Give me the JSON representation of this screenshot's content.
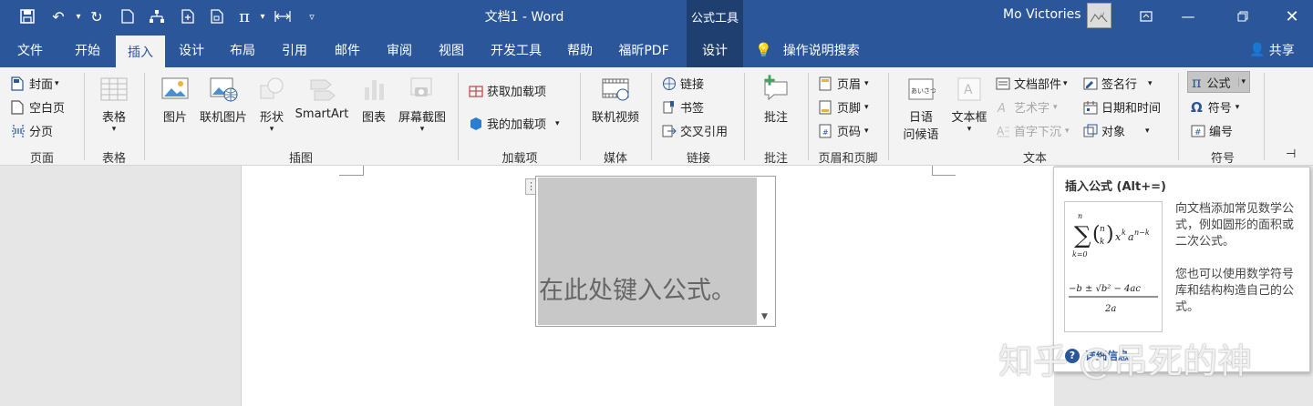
{
  "window": {
    "doc_title": "文档1 - Word",
    "context_tab": "公式工具",
    "user_name": "Mo Victories"
  },
  "menubar": {
    "tabs": [
      "文件",
      "开始",
      "插入",
      "设计",
      "布局",
      "引用",
      "邮件",
      "审阅",
      "视图",
      "开发工具",
      "帮助",
      "福昕PDF",
      "设计"
    ],
    "search": "操作说明搜索",
    "share": "共享"
  },
  "ribbon": {
    "pages": {
      "label": "页面",
      "cover": "封面",
      "blank": "空白页",
      "break": "分页"
    },
    "tables": {
      "label": "表格",
      "table": "表格"
    },
    "illustrations": {
      "label": "插图",
      "picture": "图片",
      "online_picture": "联机图片",
      "shapes": "形状",
      "smartart": "SmartArt",
      "chart": "图表",
      "screenshot": "屏幕截图"
    },
    "addins": {
      "label": "加载项",
      "get": "获取加载项",
      "mine": "我的加载项"
    },
    "media": {
      "label": "媒体",
      "online_video": "联机视频"
    },
    "links": {
      "label": "链接",
      "link": "链接",
      "bookmark": "书签",
      "cross_ref": "交叉引用"
    },
    "comments": {
      "label": "批注",
      "comment": "批注"
    },
    "header_footer": {
      "label": "页眉和页脚",
      "header": "页眉",
      "footer": "页脚",
      "page_number": "页码"
    },
    "text": {
      "label": "文本",
      "greeting_1": "日语",
      "greeting_2": "问候语",
      "textbox": "文本框",
      "quick_parts": "文档部件",
      "wordart": "艺术字",
      "dropcap": "首字下沉",
      "signature": "签名行",
      "datetime": "日期和时间",
      "object": "对象"
    },
    "symbols": {
      "label": "符号",
      "equation": "公式",
      "symbol": "符号",
      "number": "编号"
    }
  },
  "document": {
    "equation_placeholder": "在此处键入公式。"
  },
  "tooltip": {
    "title": "插入公式 (Alt+=)",
    "desc1": "向文档添加常见数学公式，例如圆形的面积或二次公式。",
    "desc2": "您也可以使用数学符号库和结构构造自己的公式。",
    "help": "详细信息"
  },
  "watermark": "知乎 @吊死的神"
}
